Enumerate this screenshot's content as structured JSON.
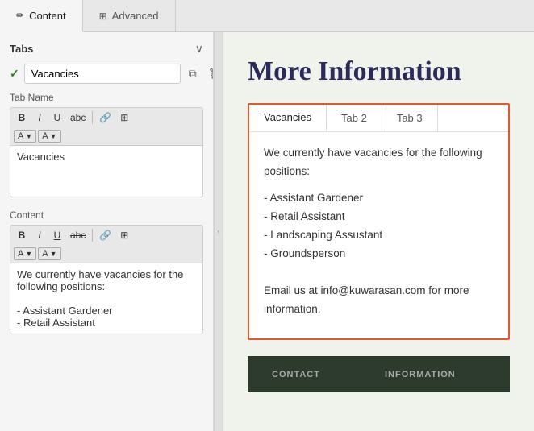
{
  "top_tabs": [
    {
      "id": "content",
      "label": "Content",
      "icon": "✏",
      "active": true
    },
    {
      "id": "advanced",
      "label": "Advanced",
      "icon": "⊞",
      "active": false
    }
  ],
  "left_panel": {
    "tabs_section": {
      "title": "Tabs",
      "tab_item": {
        "name": "Vacancies",
        "checked": true
      },
      "tab_name_label": "Tab Name",
      "toolbar1": {
        "bold": "B",
        "italic": "I",
        "underline": "U",
        "strikethrough": "abc",
        "link": "🔗",
        "grid": "⊞"
      },
      "toolbar2": {
        "font_color_label": "A",
        "font_bg_label": "A"
      },
      "tab_name_editor_value": "Vacancies"
    },
    "content_section": {
      "title": "Content",
      "toolbar1": {
        "bold": "B",
        "italic": "I",
        "underline": "U",
        "strikethrough": "abc",
        "link": "🔗",
        "grid": "⊞"
      },
      "toolbar2": {
        "font_color_label": "A",
        "font_bg_label": "A"
      },
      "content_editor_value": "We currently have vacancies for the\nfollowing positions:\n\n- Assistant Gardener\n- Retail Assistant"
    }
  },
  "right_panel": {
    "page_title": "More Information",
    "tabs": [
      {
        "id": "vacancies",
        "label": "Vacancies",
        "active": true
      },
      {
        "id": "tab2",
        "label": "Tab 2",
        "active": false
      },
      {
        "id": "tab3",
        "label": "Tab 3",
        "active": false
      }
    ],
    "vacancies_content": {
      "intro": "We currently have vacancies for the following positions:",
      "items": [
        "- Assistant Gardener",
        "- Retail Assistant",
        "- Landscaping Assustant",
        "- Groundsperson"
      ],
      "outro": "Email us at info@kuwarasan.com for more information."
    }
  },
  "bottom_bar": {
    "contact_label": "Contact",
    "information_label": "Information"
  }
}
